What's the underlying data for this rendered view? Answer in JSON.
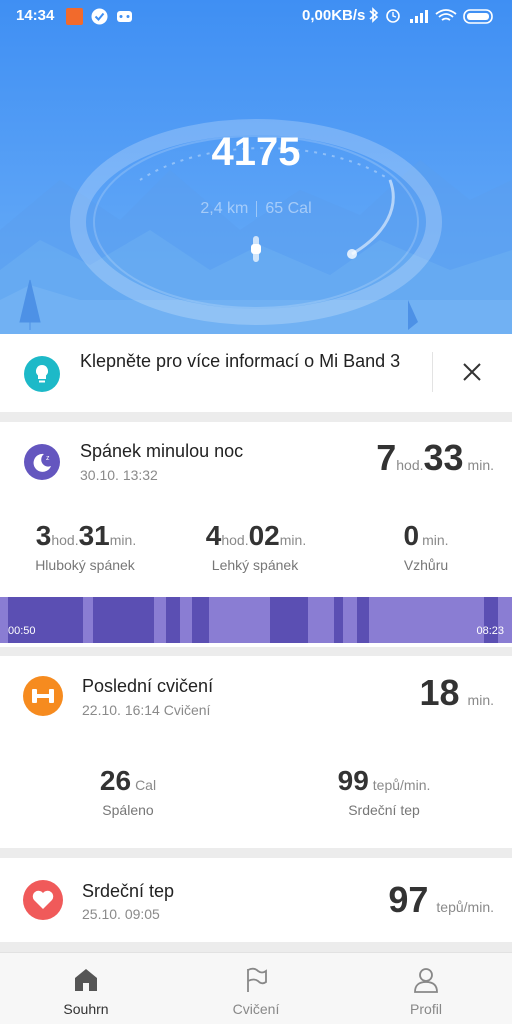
{
  "status": {
    "time": "14:34",
    "speed": "0,00KB/s"
  },
  "hero": {
    "steps": "4175",
    "distance": "2,4 km",
    "calories": "65 Cal"
  },
  "info_banner": {
    "text": "Klepněte pro více informací o Mi Band 3"
  },
  "sleep": {
    "title": "Spánek minulou noc",
    "date": "30.10. 13:32",
    "total_hours": "7",
    "hours_unit": "hod.",
    "total_minutes": "33",
    "minutes_unit": "min.",
    "deep": {
      "h": "3",
      "h_unit": "hod.",
      "m": "31",
      "m_unit": "min.",
      "label": "Hluboký spánek"
    },
    "light": {
      "h": "4",
      "h_unit": "hod.",
      "m": "02",
      "m_unit": "min.",
      "label": "Lehký spánek"
    },
    "awake": {
      "m": "0",
      "m_unit": "min.",
      "label": "Vzhůru"
    },
    "start": "00:50",
    "end": "08:23"
  },
  "exercise": {
    "title": "Poslední cvičení",
    "date": "22.10. 16:14 Cvičení",
    "minutes": "18",
    "minutes_unit": "min.",
    "calories": "26",
    "calories_unit": "Cal",
    "calories_label": "Spáleno",
    "hr": "99",
    "hr_unit": "tepů/min.",
    "hr_label": "Srdeční tep"
  },
  "heart": {
    "title": "Srdeční tep",
    "date": "25.10. 09:05",
    "value": "97",
    "unit": "tepů/min."
  },
  "nav": {
    "summary": "Souhrn",
    "exercise": "Cvičení",
    "profile": "Profil"
  },
  "colors": {
    "accent": "#4a95f4",
    "sleep": "#6456bf",
    "exercise": "#f68b1f",
    "heart": "#f05a5a",
    "info": "#1db9c8"
  }
}
